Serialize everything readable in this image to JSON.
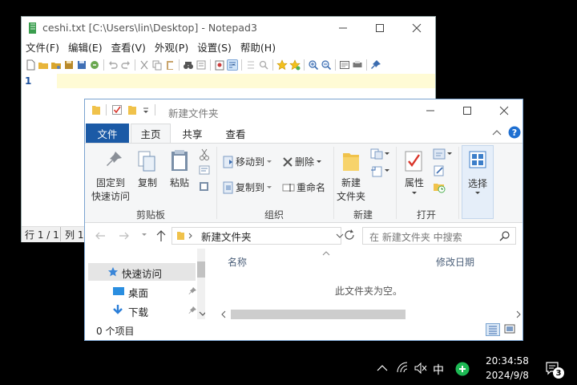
{
  "notepad": {
    "title": "ceshi.txt [C:\\Users\\lin\\Desktop] - Notepad3",
    "menu": [
      "文件(F)",
      "编辑(E)",
      "查看(V)",
      "外观(P)",
      "设置(S)",
      "帮助(H)"
    ],
    "line_number": "1",
    "status": {
      "position": "行 1 / 1",
      "column": "列 1"
    }
  },
  "explorer": {
    "title": "新建文件夹",
    "tabs": {
      "file": "文件",
      "home": "主页",
      "share": "共享",
      "view": "查看"
    },
    "ribbon": {
      "pin_label": [
        "固定到",
        "快速访问"
      ],
      "copy": "复制",
      "paste": "粘贴",
      "clipboard_group": "剪贴板",
      "move_to": "移动到",
      "copy_to": "复制到",
      "delete": "删除",
      "rename": "重命名",
      "organize_group": "组织",
      "new_folder": [
        "新建",
        "文件夹"
      ],
      "new_group": "新建",
      "properties": "属性",
      "open_group": "打开",
      "select": "选择"
    },
    "address": {
      "crumb": "新建文件夹",
      "search_placeholder": "在 新建文件夹 中搜索"
    },
    "nav": {
      "quick_access": "快速访问",
      "desktop": "桌面",
      "downloads": "下载"
    },
    "columns": {
      "name": "名称",
      "modified": "修改日期"
    },
    "empty_message": "此文件夹为空。",
    "status": "0 个项目"
  },
  "taskbar": {
    "ime": "中",
    "time": "20:34:58",
    "date": "2024/9/8",
    "notifications": "3"
  },
  "colors": {
    "accent": "#1b5aa6",
    "current_line": "#fffbd5",
    "help": "#1e6fd1"
  }
}
